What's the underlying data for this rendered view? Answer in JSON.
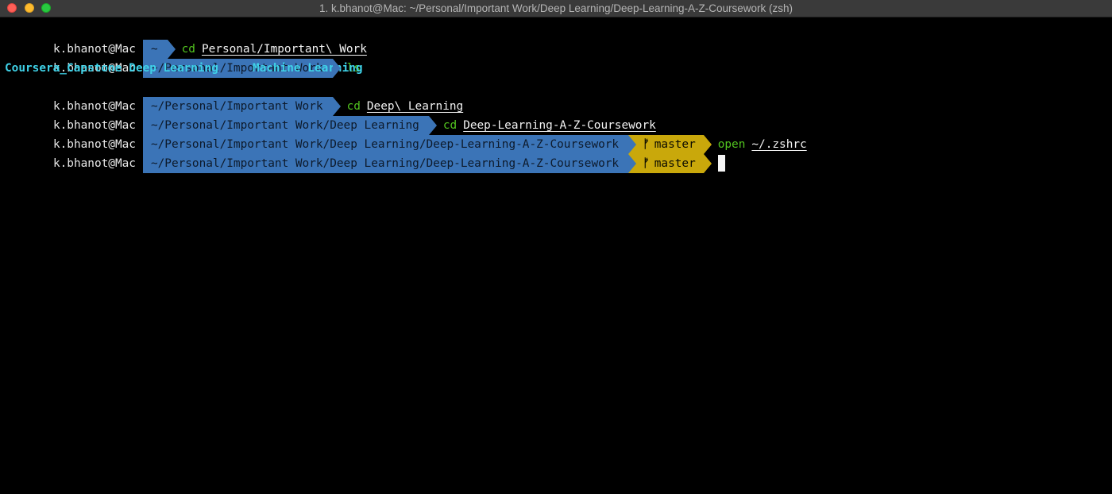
{
  "window": {
    "title": "1. k.bhanot@Mac: ~/Personal/Important Work/Deep Learning/Deep-Learning-A-Z-Coursework (zsh)"
  },
  "colors": {
    "background": "#000000",
    "dir_segment": "#3b74b7",
    "git_segment": "#c9a80b",
    "command": "#52c41f",
    "ls_directories": "#3fd2e8"
  },
  "prompt": {
    "user_host": "k.bhanot@Mac",
    "branch_icon": "git-branch-icon"
  },
  "lines": [
    {
      "dir": "~",
      "command": "cd",
      "argument": "Personal/Important\\ Work"
    },
    {
      "dir": "~/Personal/Important Work",
      "command": "ls",
      "argument": ""
    },
    {
      "dir": "~/Personal/Important Work",
      "command": "cd",
      "argument": "Deep\\ Learning"
    },
    {
      "dir": "~/Personal/Important Work/Deep Learning",
      "command": "cd",
      "argument": "Deep-Learning-A-Z-Coursework"
    },
    {
      "dir": "~/Personal/Important Work/Deep Learning/Deep-Learning-A-Z-Coursework",
      "branch": "master",
      "command": "open",
      "argument": "~/.zshrc"
    },
    {
      "dir": "~/Personal/Important Work/Deep Learning/Deep-Learning-A-Z-Coursework",
      "branch": "master",
      "command": "",
      "argument": ""
    }
  ],
  "ls_output": [
    "Coursera_Capstone",
    "Deep Learning",
    "Machine Learning"
  ]
}
